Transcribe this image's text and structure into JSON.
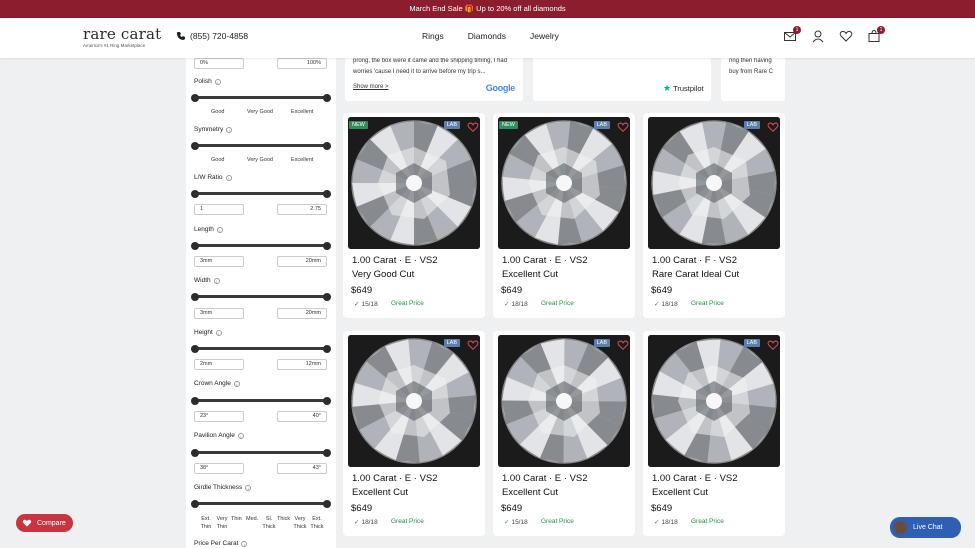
{
  "promo": {
    "text": "March End Sale 🎁 Up to 20% off all diamonds"
  },
  "header": {
    "logo_text": "rare carat",
    "logo_sub": "America's #1 Ring Marketplace",
    "phone": "(855) 720-4858",
    "nav": [
      "Rings",
      "Diamonds",
      "Jewelry"
    ],
    "mail_count": "1",
    "cart_count": "1"
  },
  "filters": {
    "depth": {
      "min": "0%",
      "max": "100%"
    },
    "polish": {
      "label": "Polish",
      "ticks": [
        "Good",
        "Very Good",
        "Excellent"
      ]
    },
    "symmetry": {
      "label": "Symmetry",
      "ticks": [
        "Good",
        "Very Good",
        "Excellent"
      ]
    },
    "lw_ratio": {
      "label": "L/W Ratio",
      "min": "1",
      "max": "2.75"
    },
    "length": {
      "label": "Length",
      "min": "3mm",
      "max": "20mm"
    },
    "width": {
      "label": "Width",
      "min": "3mm",
      "max": "20mm"
    },
    "height": {
      "label": "Height",
      "min": "2mm",
      "max": "12mm"
    },
    "crown_angle": {
      "label": "Crown Angle",
      "min": "23°",
      "max": "40°"
    },
    "pavilion_angle": {
      "label": "Pavilion Angle",
      "min": "38°",
      "max": "43°"
    },
    "girdle": {
      "label": "Girdle Thickness",
      "ticks": [
        "Ext. Thin",
        "Very Thin",
        "Thin",
        "Med.",
        "Sl. Thick",
        "Thick",
        "Very Thick",
        "Ext. Thick"
      ]
    },
    "price_per_carat": {
      "label": "Price Per Carat"
    }
  },
  "reviews": {
    "text_1": "prong, the box were it came and the shipping timing, I had worries 'cause I need it to arrive before my trip s...",
    "show_more": "Show more >",
    "google": "Google",
    "trustpilot": "Trustpilot",
    "text_3": "ring then having buy from Rare C"
  },
  "products": [
    {
      "title": "1.00 Carat · E · VS2",
      "cut": "Very Good Cut",
      "price": "$649",
      "score": "15/18",
      "rating": "Great Price",
      "new": "NEW",
      "lab": "LAB"
    },
    {
      "title": "1.00 Carat · E · VS2",
      "cut": "Excellent Cut",
      "price": "$649",
      "score": "18/18",
      "rating": "Great Price",
      "new": "NEW",
      "lab": "LAB"
    },
    {
      "title": "1.00 Carat · F · VS2",
      "cut": "Rare Carat Ideal Cut",
      "price": "$649",
      "score": "18/18",
      "rating": "Great Price",
      "new": "",
      "lab": "LAB"
    },
    {
      "title": "1.00 Carat · E · VS2",
      "cut": "Excellent Cut",
      "price": "$649",
      "score": "18/18",
      "rating": "Great Price",
      "new": "",
      "lab": "LAB"
    },
    {
      "title": "1.00 Carat · E · VS2",
      "cut": "Excellent Cut",
      "price": "$649",
      "score": "15/18",
      "rating": "Great Price",
      "new": "",
      "lab": "LAB"
    },
    {
      "title": "1.00 Carat · E · VS2",
      "cut": "Excellent Cut",
      "price": "$649",
      "score": "18/18",
      "rating": "Great Price",
      "new": "",
      "lab": "LAB"
    }
  ],
  "compare_label": "Compare",
  "chat_label": "Live Chat"
}
